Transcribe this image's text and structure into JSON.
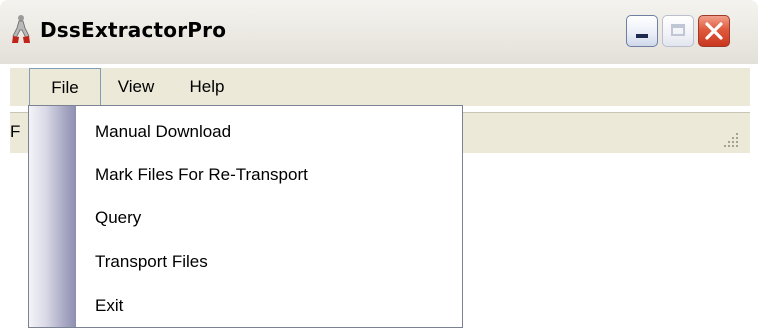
{
  "window": {
    "title": "DssExtractorPro",
    "icon": "app-logo-icon",
    "controls": {
      "minimize": "minimize-icon",
      "maximize": "maximize-icon",
      "close": "close-icon"
    }
  },
  "menubar": {
    "items": [
      {
        "label": "File",
        "active": true
      },
      {
        "label": "View",
        "active": false
      },
      {
        "label": "Help",
        "active": false
      }
    ]
  },
  "statusbar": {
    "text": "F"
  },
  "file_menu": {
    "items": [
      {
        "label": "Manual Download"
      },
      {
        "label": "Mark Files For Re-Transport"
      },
      {
        "label": "Query"
      },
      {
        "label": "Transport Files"
      },
      {
        "label": "Exit"
      }
    ]
  },
  "colors": {
    "titlebar": "#ebe9e2",
    "menubar": "#ece9d8",
    "close_button": "#e05a3e",
    "dropdown_strip": "#a8a8c4"
  }
}
